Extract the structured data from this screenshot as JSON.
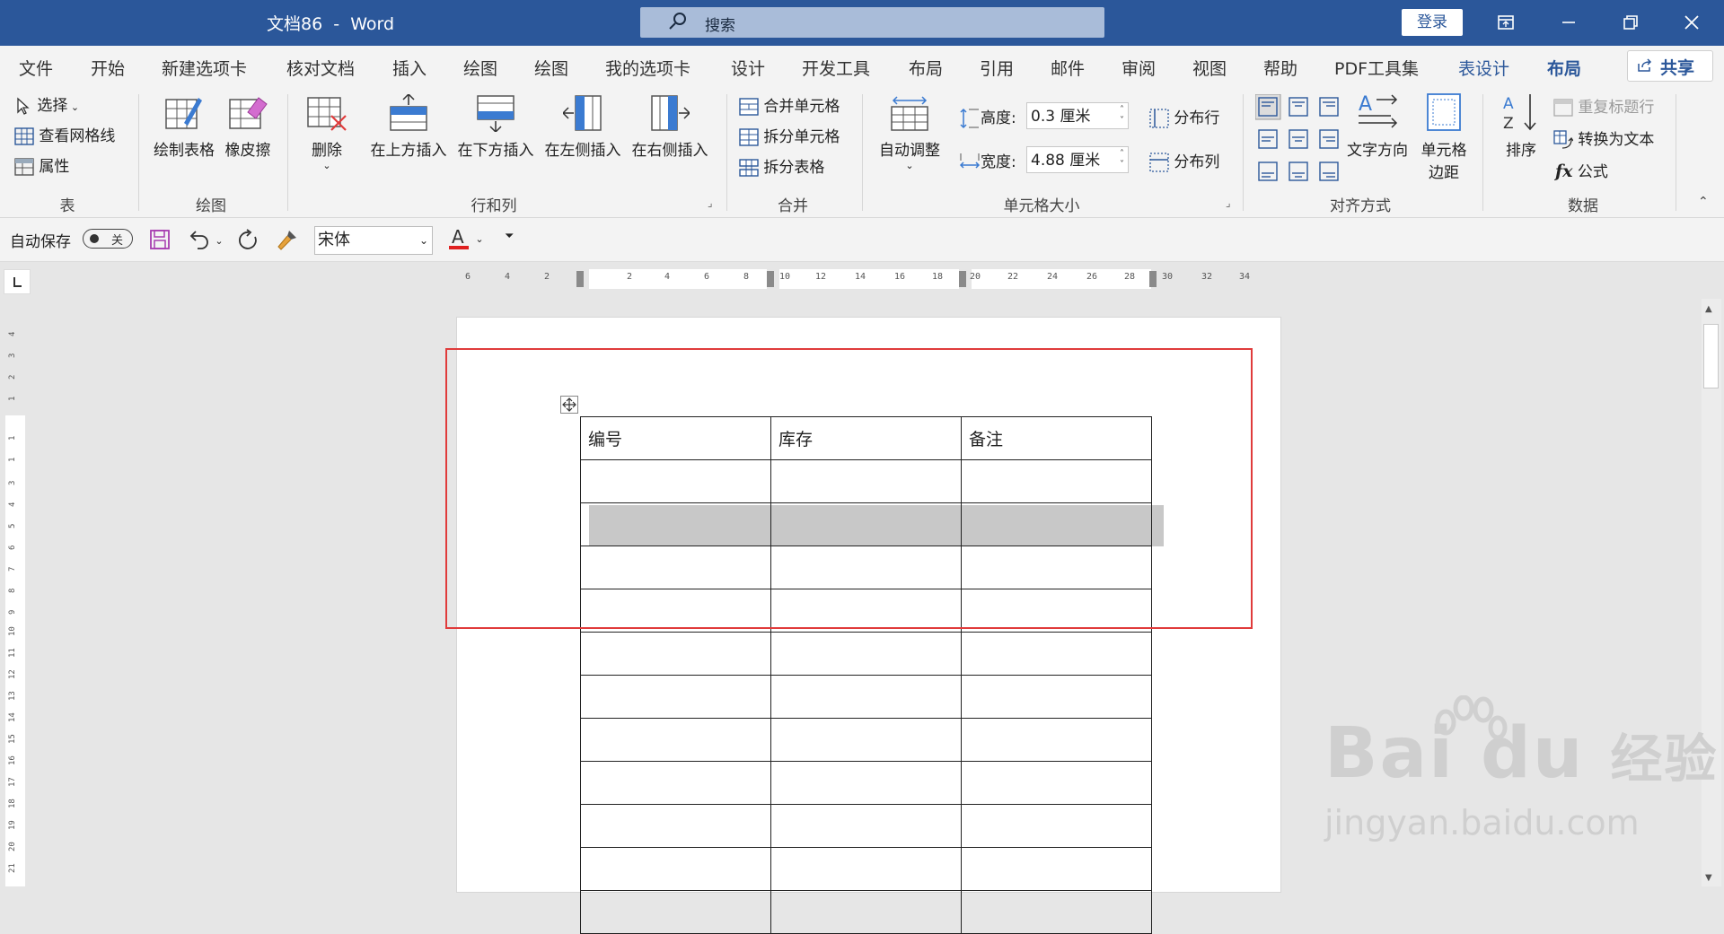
{
  "window": {
    "title": "文档86  -  Word",
    "search_label": "搜索",
    "login_label": "登录"
  },
  "tabs": [
    "文件",
    "开始",
    "新建选项卡",
    "核对文档",
    "插入",
    "绘图",
    "绘图",
    "我的选项卡",
    "设计",
    "开发工具",
    "布局",
    "引用",
    "邮件",
    "审阅",
    "视图",
    "帮助",
    "PDF工具集",
    "表设计",
    "布局"
  ],
  "share_label": "共享",
  "ribbon": {
    "table_group": {
      "label": "表",
      "select": "选择",
      "gridlines": "查看网格线",
      "properties": "属性"
    },
    "draw_group": {
      "label": "绘图",
      "draw_table": "绘制表格",
      "eraser": "橡皮擦"
    },
    "rows_group": {
      "label": "行和列",
      "delete": "删除",
      "insert_above": "在上方插入",
      "insert_below": "在下方插入",
      "insert_left": "在左侧插入",
      "insert_right": "在右侧插入"
    },
    "merge_group": {
      "label": "合并",
      "merge_cells": "合并单元格",
      "split_cells": "拆分单元格",
      "split_table": "拆分表格"
    },
    "size_group": {
      "label": "单元格大小",
      "autofit": "自动调整",
      "height_label": "高度:",
      "height_value": "0.3 厘米",
      "width_label": "宽度:",
      "width_value": "4.88 厘米",
      "distribute_rows": "分布行",
      "distribute_cols": "分布列"
    },
    "align_group": {
      "label": "对齐方式",
      "text_direction": "文字方向",
      "cell_margins_1": "单元格",
      "cell_margins_2": "边距"
    },
    "data_group": {
      "label": "数据",
      "sort": "排序",
      "repeat_header": "重复标题行",
      "convert_text": "转换为文本",
      "formula": "公式"
    }
  },
  "qat": {
    "autosave_label": "自动保存",
    "toggle_state": "关",
    "font_name": "宋体",
    "font_color": "#e02020"
  },
  "ruler": {
    "h_marks": [
      "6",
      "4",
      "2",
      "2",
      "4",
      "6",
      "8",
      "10",
      "12",
      "14",
      "16",
      "18",
      "20",
      "22",
      "24",
      "26",
      "28",
      "30",
      "32",
      "34"
    ],
    "v_marks": [
      "4",
      "3",
      "2",
      "1",
      "1",
      "1",
      "3",
      "4",
      "5",
      "6",
      "7",
      "8",
      "9",
      "10",
      "11",
      "12",
      "13",
      "14",
      "15",
      "16",
      "17",
      "18",
      "19",
      "20",
      "21"
    ]
  },
  "document": {
    "headers": [
      "编号",
      "库存",
      "备注"
    ],
    "row_count": 11
  },
  "watermark": {
    "brand": "Bai du",
    "suffix": "经验",
    "url": "jingyan.baidu.com"
  }
}
